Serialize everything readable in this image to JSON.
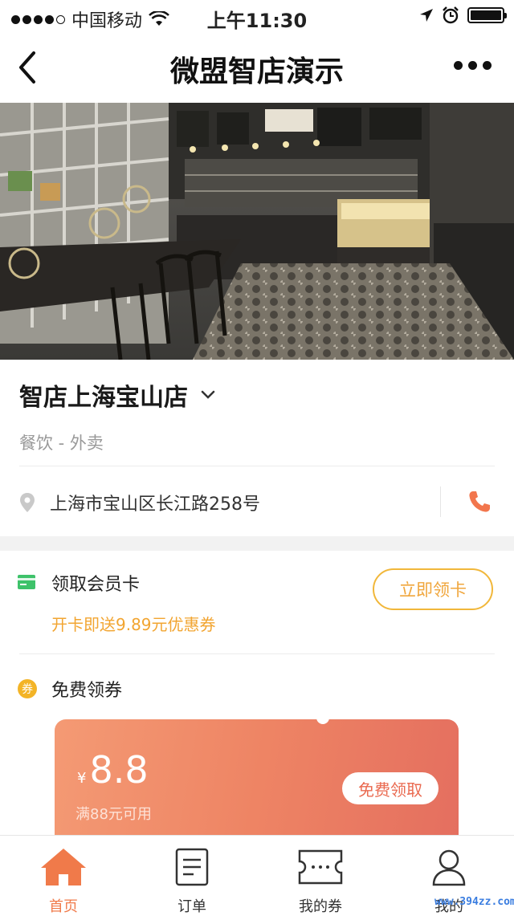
{
  "status_bar": {
    "carrier": "中国移动",
    "time": "上午11:30",
    "signal_dots_filled": 4,
    "signal_dots_total": 5,
    "battery_level": 1.0,
    "icons": [
      "wifi-icon",
      "location-arrow-icon",
      "alarm-icon",
      "battery-icon"
    ]
  },
  "nav": {
    "title": "微盟智店演示",
    "back_icon": "back-chevron-icon",
    "more_icon": "more-dots-icon"
  },
  "store": {
    "name": "智店上海宝山店",
    "category": "餐饮 - 外卖",
    "address": "上海市宝山区长江路258号",
    "icons": [
      "chevron-down-icon",
      "location-pin-icon",
      "phone-icon"
    ]
  },
  "member_card": {
    "title": "领取会员卡",
    "subtitle": "开卡即送9.89元优惠券",
    "button": "立即领卡"
  },
  "coupons": {
    "title": "免费领券",
    "badge": "券",
    "items": [
      {
        "currency": "¥",
        "amount": "8.8",
        "condition": "满88元可用",
        "button": "免费领取"
      }
    ]
  },
  "tabbar": {
    "items": [
      {
        "label": "首页",
        "icon": "home-icon",
        "active": true
      },
      {
        "label": "订单",
        "icon": "order-icon",
        "active": false
      },
      {
        "label": "我的券",
        "icon": "ticket-icon",
        "active": false
      },
      {
        "label": "我的",
        "icon": "user-icon",
        "active": false
      }
    ]
  },
  "colors": {
    "accent": "#f07a4a",
    "member_accent": "#f2a531",
    "coupon_gradient_start": "#f49a74",
    "coupon_gradient_end": "#e46e5f"
  },
  "watermark": "www.394zz.com"
}
